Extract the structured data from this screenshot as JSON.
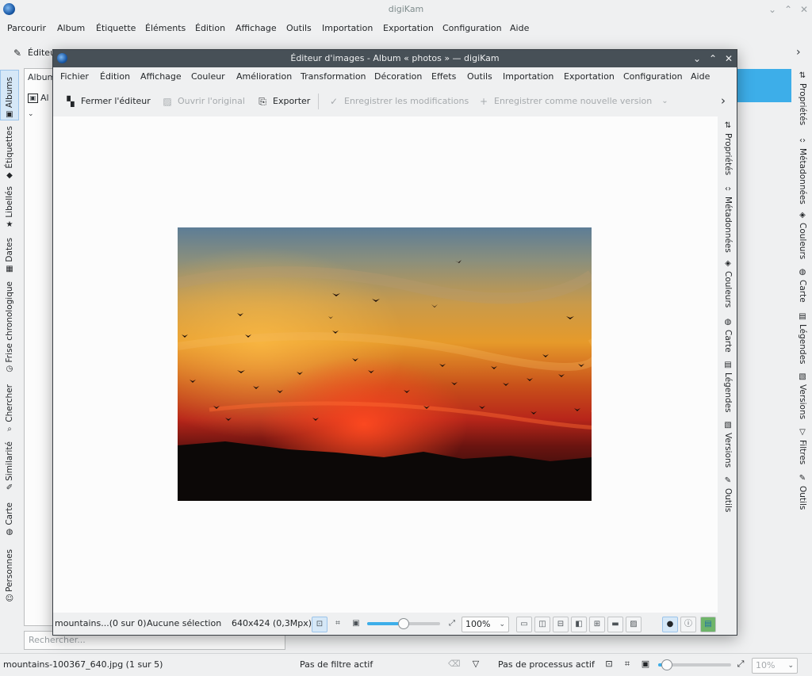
{
  "main": {
    "title": "digiKam",
    "menu": [
      "Parcourir",
      "Album",
      "Étiquette",
      "Éléments",
      "Édition",
      "Affichage",
      "Outils",
      "Importation",
      "Exportation",
      "Configuration",
      "Aide"
    ],
    "toolbar_first_label": "Éditeu",
    "left_tabs": [
      "Albums",
      "Étiquettes",
      "Libellés",
      "Dates",
      "Frise chronologique",
      "Chercher",
      "Similarité",
      "Carte",
      "Personnes"
    ],
    "left_tab_icons": [
      "album-icon",
      "tag-icon",
      "star-icon",
      "calendar-icon",
      "clock-icon",
      "search-icon",
      "brush-icon",
      "globe-icon",
      "face-icon"
    ],
    "left_panel_header": "Album",
    "left_panel_item": "Al",
    "search_placeholder": "Rechercher...",
    "right_tabs": [
      "Propriétés",
      "Métadonnées",
      "Couleurs",
      "Carte",
      "Légendes",
      "Versions",
      "Filtres",
      "Outils"
    ],
    "status_file": "mountains-100367_640.jpg (1 sur 5)",
    "status_filter": "Pas de filtre actif",
    "status_process": "Pas de processus actif",
    "zoom_value": "10%",
    "zoom_fraction": 0.12
  },
  "editor": {
    "title": "Éditeur d'images - Album « photos » — digiKam",
    "menu": [
      "Fichier",
      "Édition",
      "Affichage",
      "Couleur",
      "Amélioration",
      "Transformation",
      "Décoration",
      "Effets",
      "Outils",
      "Importation",
      "Exportation",
      "Configuration",
      "Aide"
    ],
    "toolbar": {
      "close_label": "Fermer l'éditeur",
      "open_original_label": "Ouvrir l'original",
      "export_label": "Exporter",
      "save_label": "Enregistrer les modifications",
      "save_version_label": "Enregistrer comme nouvelle version"
    },
    "right_tabs": [
      "Propriétés",
      "Métadonnées",
      "Couleurs",
      "Carte",
      "Légendes",
      "Versions",
      "Outils"
    ],
    "status": {
      "file": "mountains...(0 sur 0)",
      "selection": "Aucune sélection",
      "size": "640x424 (0,3Mpx)",
      "zoom_value": "100%",
      "zoom_fraction": 0.5
    }
  },
  "colors": {
    "accent": "#3daee9",
    "editor_titlebar": "#475057"
  }
}
